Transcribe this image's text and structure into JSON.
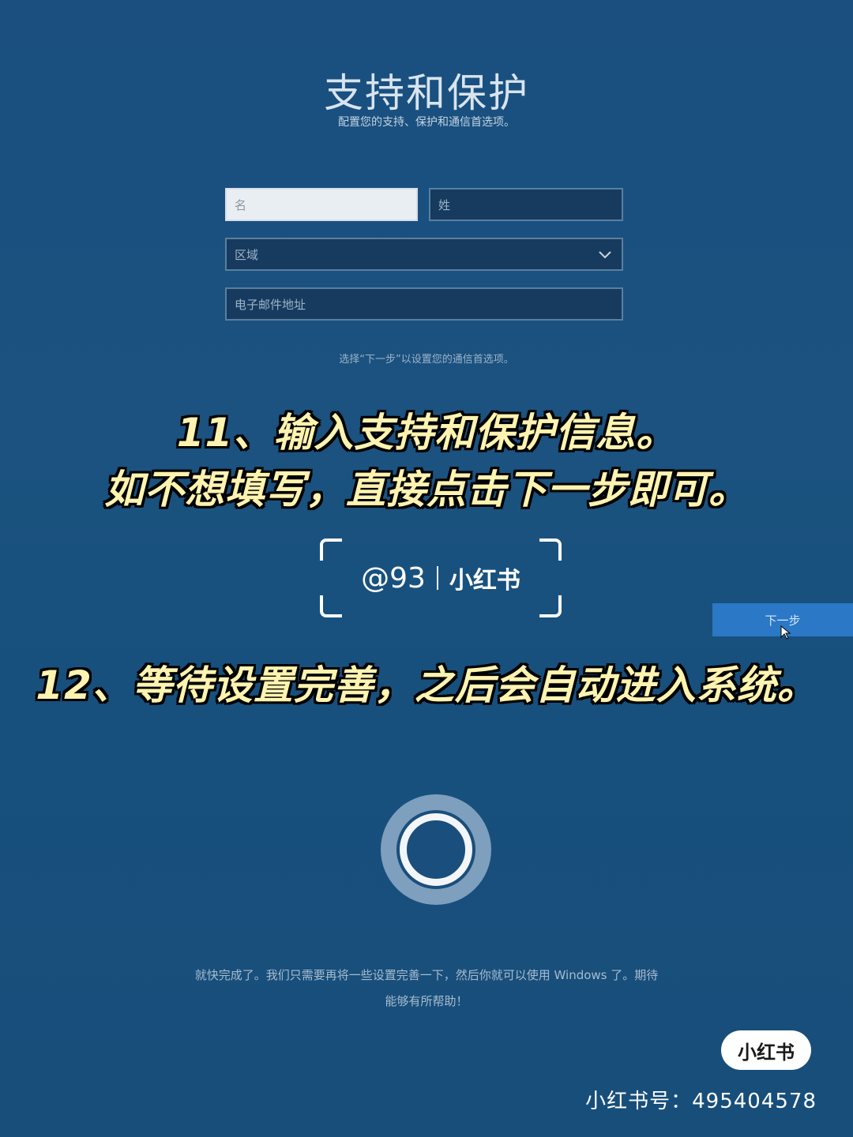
{
  "oobe": {
    "title": "支持和保护",
    "subtitle": "配置您的支持、保护和通信首选项。",
    "first_name_placeholder": "名",
    "last_name_placeholder": "姓",
    "region_placeholder": "区域",
    "email_placeholder": "电子邮件地址",
    "hint": "选择“下一步”以设置您的通信首选项。",
    "next_label": "下一步"
  },
  "captions": {
    "step11_line1": "11、输入支持和保护信息。",
    "step11_line2": "如不想填写，直接点击下一步即可。",
    "step12": "12、等待设置完善，之后会自动进入系统。"
  },
  "watermark": {
    "handle": "@93",
    "brand": "小红书"
  },
  "loading": {
    "line1": "就快完成了。我们只需要再将一些设置完善一下，然后你就可以使用 Windows 了。期待",
    "line2": "能够有所帮助！"
  },
  "branding": {
    "badge": "小红书",
    "id_text": "小红书号：495404578"
  },
  "colors": {
    "background": "#1a4f7f",
    "caption_text": "#fff3b0",
    "next_button": "#2a78c6"
  }
}
